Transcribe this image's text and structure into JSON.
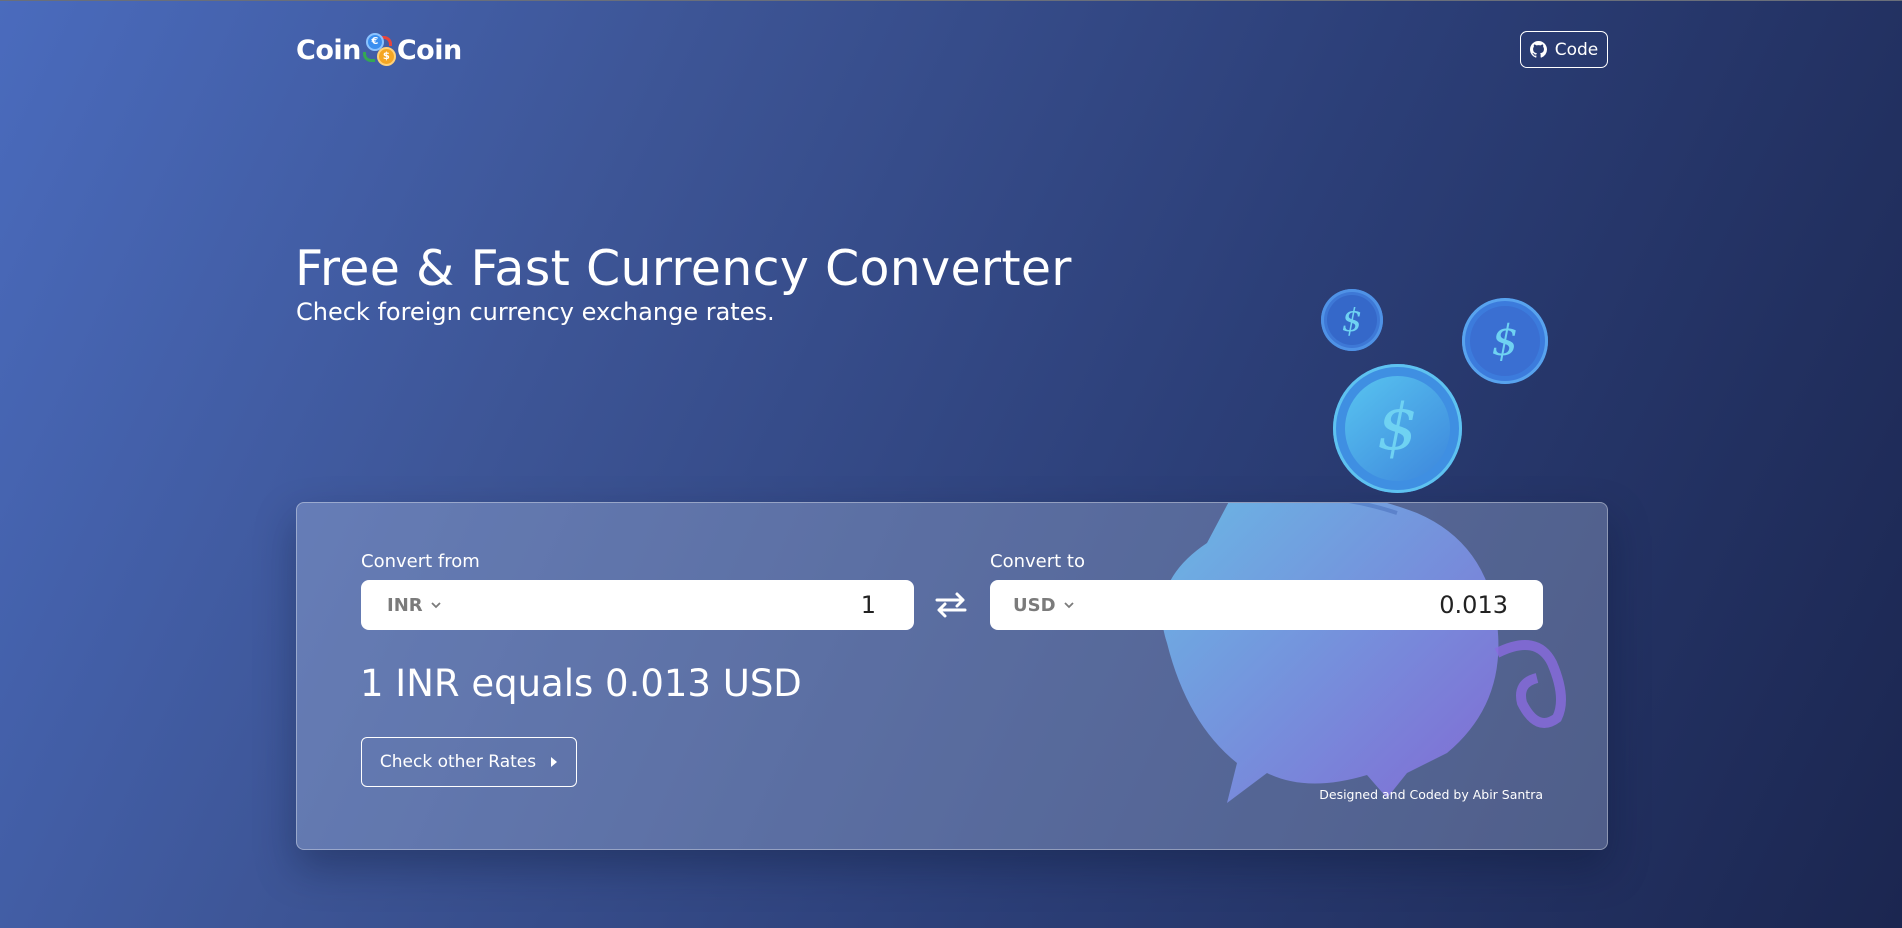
{
  "header": {
    "logo": {
      "left_word": "Coin",
      "right_word": "Coin",
      "coin1_symbol": "€",
      "coin2_symbol": "$"
    },
    "code_button": {
      "label": "Code",
      "icon": "github-icon"
    }
  },
  "hero": {
    "title": "Free & Fast Currency Converter",
    "subtitle": "Check foreign currency exchange rates."
  },
  "decor": {
    "coin_symbol": "$"
  },
  "converter": {
    "from": {
      "label": "Convert from",
      "currency": "INR",
      "amount": "1"
    },
    "to": {
      "label": "Convert to",
      "currency": "USD",
      "amount": "0.013"
    },
    "swap_icon": "swap-arrows-icon",
    "result_text": "1 INR equals 0.013 USD",
    "rates_button": {
      "label": "Check other Rates",
      "icon": "caret-right-icon"
    },
    "credit": "Designed and Coded by Abir Santra"
  },
  "colors": {
    "background_start": "#4a6bbd",
    "background_end": "#1b2650",
    "card_tint": "rgba(190,205,240,0.30)",
    "coin_blue": "#3f8fe2",
    "coin_symbol": "#6fd2f2",
    "text_primary": "#ffffff",
    "select_text": "#7b7b7b"
  }
}
